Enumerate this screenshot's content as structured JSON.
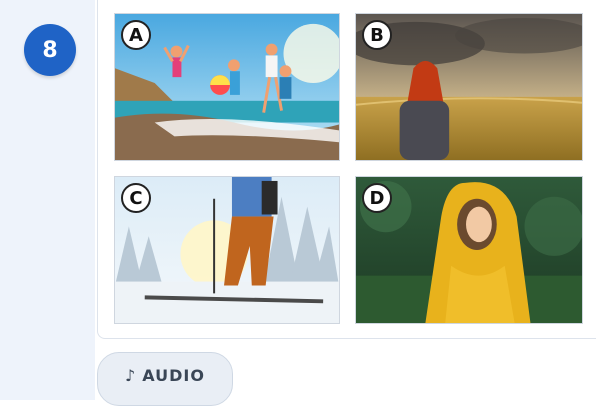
{
  "question": {
    "number": "8"
  },
  "options": [
    {
      "letter": "A",
      "image": "kids-jumping-on-beach"
    },
    {
      "letter": "B",
      "image": "woman-in-wheat-field-under-storm"
    },
    {
      "letter": "C",
      "image": "skier-in-snowy-forest"
    },
    {
      "letter": "D",
      "image": "girl-in-yellow-raincoat-in-forest"
    }
  ],
  "audio": {
    "icon": "♪",
    "label": "AUDIO"
  }
}
